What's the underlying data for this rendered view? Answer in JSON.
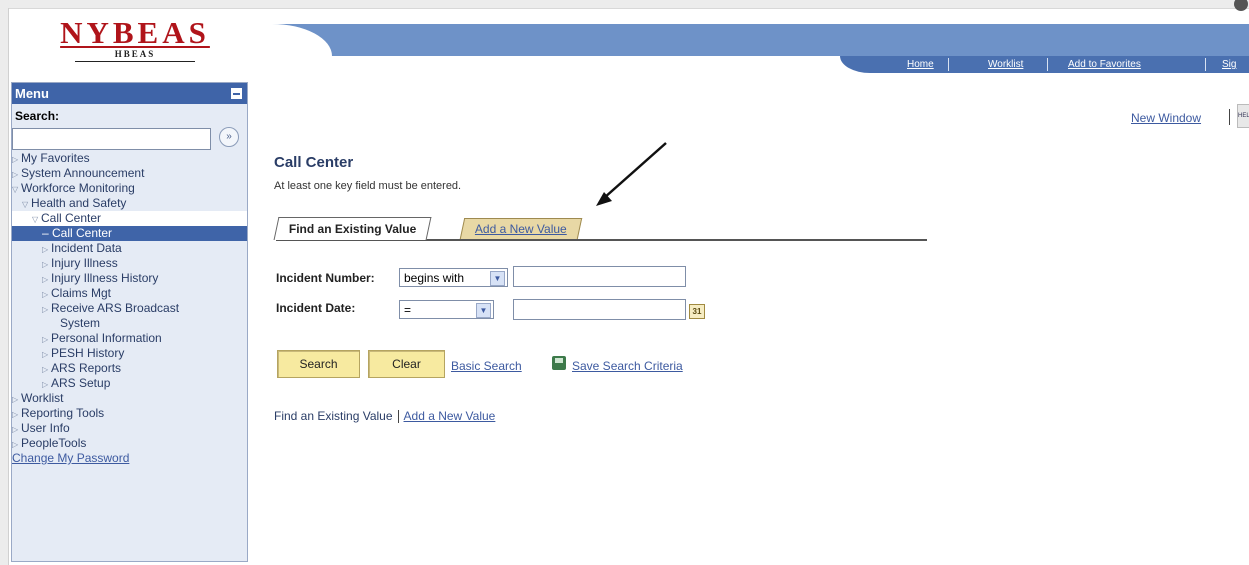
{
  "logo": {
    "main": "NYBEAS",
    "sub": "HBEAS"
  },
  "nav": {
    "home": "Home",
    "worklist": "Worklist",
    "favorites": "Add to Favorites",
    "signout": "Sig"
  },
  "menu": {
    "title": "Menu",
    "search_label": "Search:",
    "search_value": "",
    "items": [
      {
        "label": "My Favorites"
      },
      {
        "label": "System Announcement"
      },
      {
        "label": "Workforce Monitoring"
      },
      {
        "label": "Health and Safety"
      },
      {
        "label": "Call Center"
      },
      {
        "label": "– Call Center"
      },
      {
        "label": "Incident Data"
      },
      {
        "label": "Injury Illness"
      },
      {
        "label": "Injury Illness History"
      },
      {
        "label": "Claims Mgt"
      },
      {
        "label": "Receive ARS Broadcast"
      },
      {
        "label": "System"
      },
      {
        "label": "Personal Information"
      },
      {
        "label": "PESH History"
      },
      {
        "label": "ARS Reports"
      },
      {
        "label": "ARS Setup"
      },
      {
        "label": "Worklist"
      },
      {
        "label": "Reporting Tools"
      },
      {
        "label": "User Info"
      },
      {
        "label": "PeopleTools"
      },
      {
        "label": "Change My Password"
      }
    ]
  },
  "topright": {
    "new_window": "New Window",
    "help": "HELP"
  },
  "page": {
    "title": "Call Center",
    "subtitle": "At least one key field must be entered.",
    "tabs": [
      "Find an Existing Value",
      "Add a New Value"
    ],
    "fields": {
      "incident_number_label": "Incident Number:",
      "incident_number_op": "begins with",
      "incident_number_value": "",
      "incident_date_label": "Incident Date:",
      "incident_date_op": "=",
      "incident_date_value": "",
      "calendar_label": "31"
    },
    "buttons": {
      "search": "Search",
      "clear": "Clear"
    },
    "links": {
      "basic_search": "Basic Search",
      "save_search": "Save Search Criteria"
    },
    "bottom": {
      "find": "Find an Existing Value",
      "add": "Add a New Value"
    }
  },
  "colors": {
    "accent": "#3f64a8",
    "button": "#f7eaa0",
    "tab_inactive": "#e8d8a5",
    "logo": "#b0141a"
  }
}
